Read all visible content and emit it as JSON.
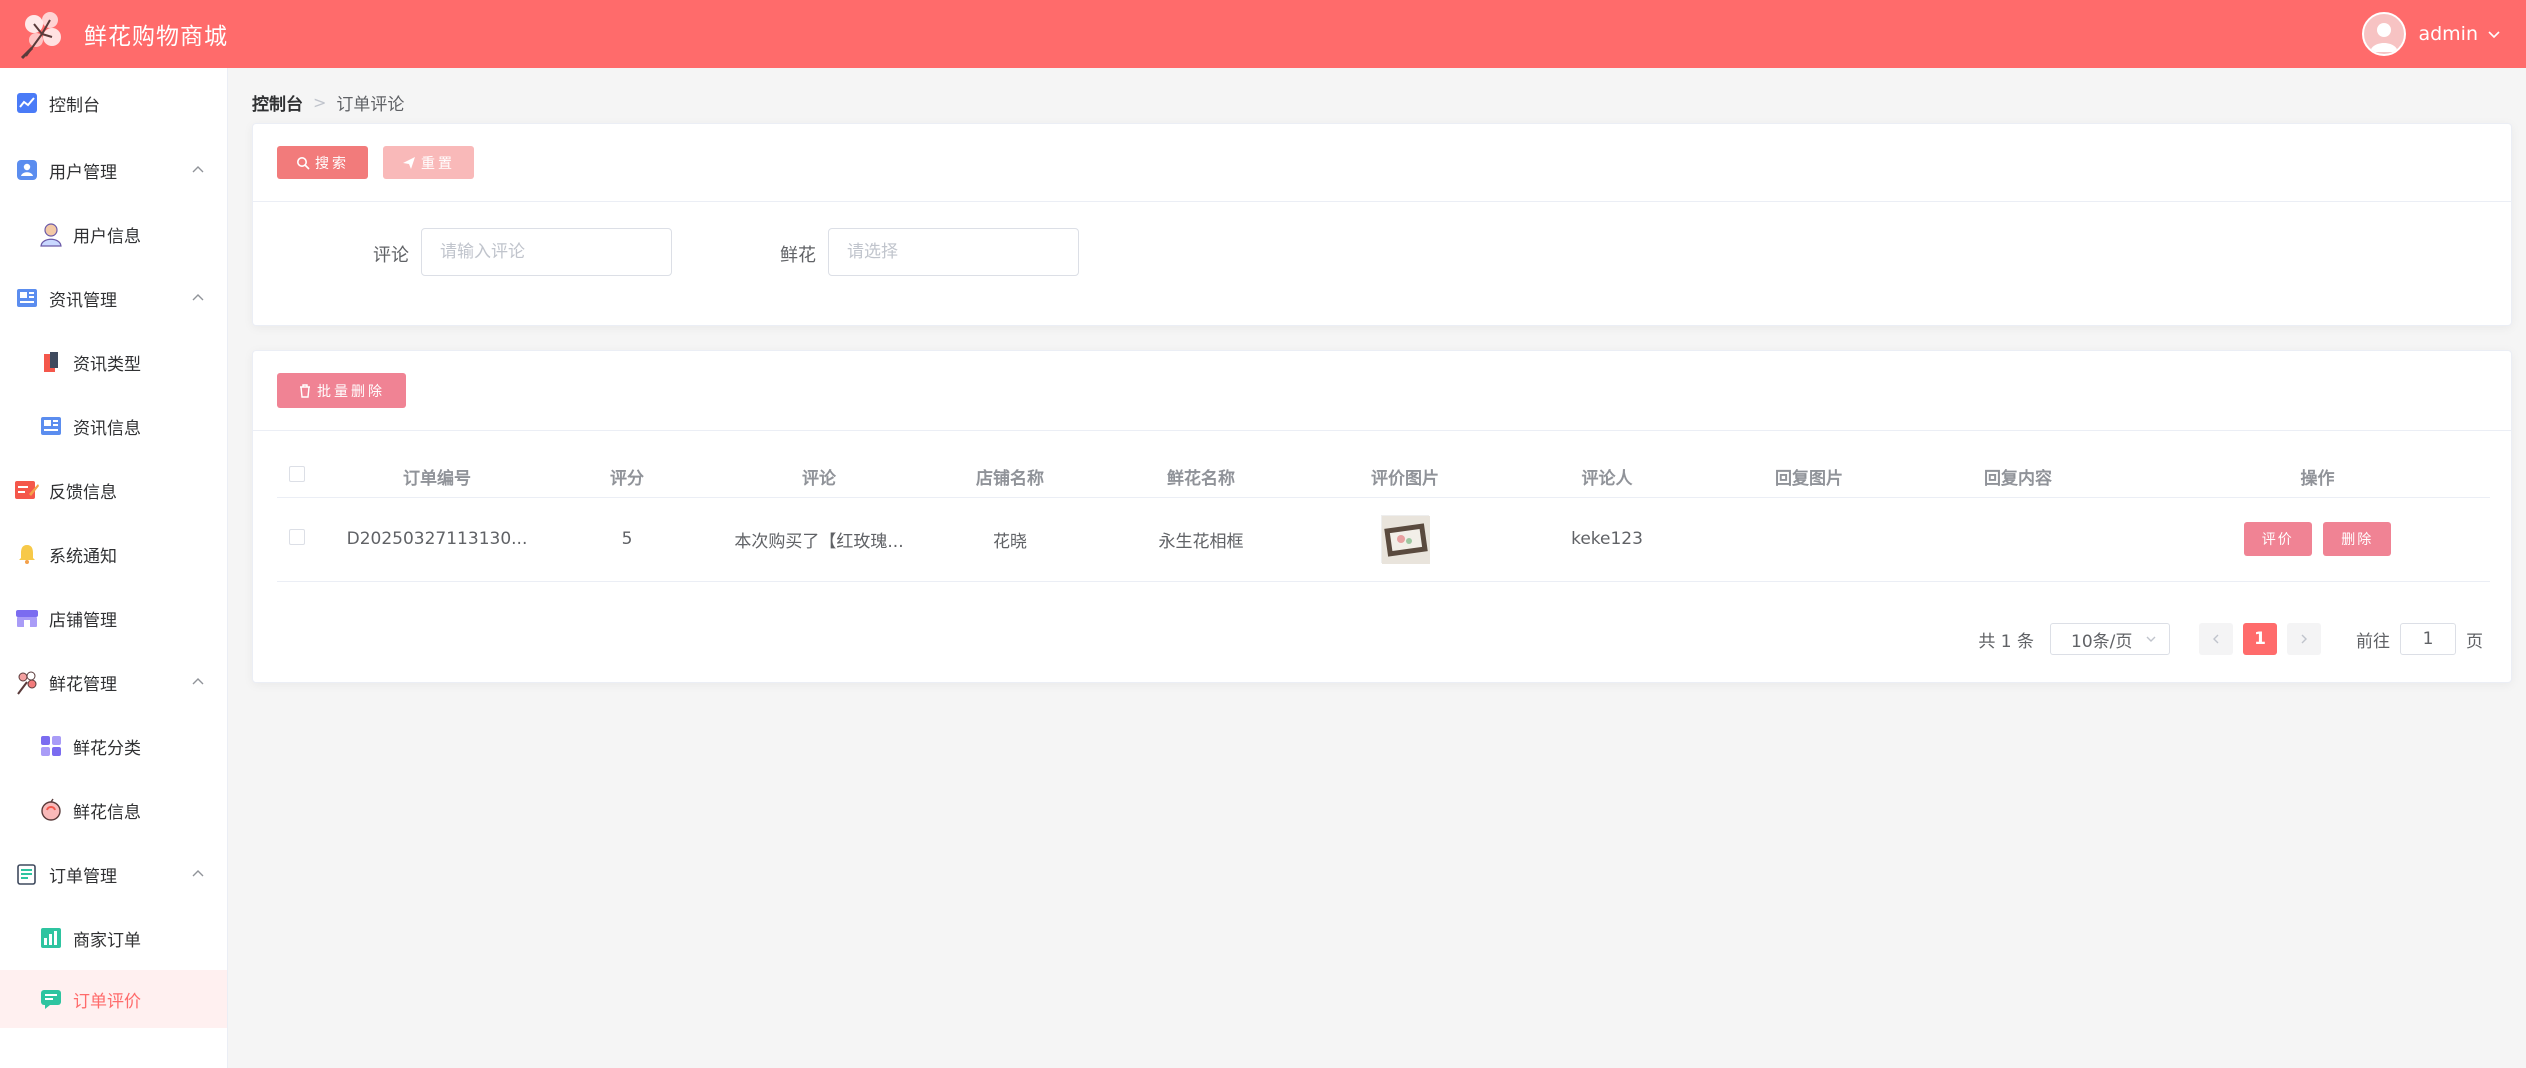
{
  "header": {
    "title": "鲜花购物商城",
    "user": "admin"
  },
  "sidebar": {
    "items": [
      {
        "label": "控制台"
      },
      {
        "label": "用户管理"
      },
      {
        "label": "用户信息"
      },
      {
        "label": "资讯管理"
      },
      {
        "label": "资讯类型"
      },
      {
        "label": "资讯信息"
      },
      {
        "label": "反馈信息"
      },
      {
        "label": "系统通知"
      },
      {
        "label": "店铺管理"
      },
      {
        "label": "鲜花管理"
      },
      {
        "label": "鲜花分类"
      },
      {
        "label": "鲜花信息"
      },
      {
        "label": "订单管理"
      },
      {
        "label": "商家订单"
      },
      {
        "label": "订单评价"
      }
    ]
  },
  "breadcrumb": {
    "root": "控制台",
    "current": "订单评论"
  },
  "toolbar": {
    "search": "搜索",
    "reset": "重置",
    "batch_delete": "批量删除"
  },
  "filters": {
    "comment_label": "评论",
    "comment_placeholder": "请输入评论",
    "flower_label": "鲜花",
    "flower_placeholder": "请选择"
  },
  "table": {
    "headers": [
      "订单编号",
      "评分",
      "评论",
      "店铺名称",
      "鲜花名称",
      "评价图片",
      "评论人",
      "回复图片",
      "回复内容",
      "操作"
    ],
    "rows": [
      {
        "order_no": "D20250327113130...",
        "score": "5",
        "comment": "本次购买了【红玫瑰...",
        "shop": "花晓",
        "flower": "永生花相框",
        "reviewer": "keke123",
        "reply_image": "",
        "reply_content": ""
      }
    ],
    "actions": {
      "evaluate": "评价",
      "delete": "删除"
    }
  },
  "pagination": {
    "total": "共 1 条",
    "page_size": "10条/页",
    "current": "1",
    "goto": "前往",
    "goto_value": "1",
    "page": "页"
  },
  "colors": {
    "primary": "#ff6b6b",
    "btn_search": "#f27b7b",
    "btn_reset": "#f9b9b9",
    "btn_danger": "#f08394"
  }
}
